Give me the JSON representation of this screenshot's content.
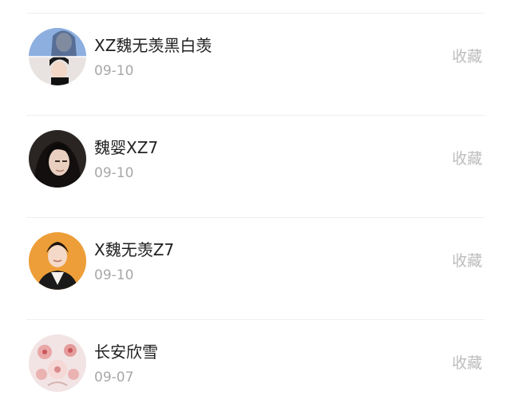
{
  "users": [
    {
      "name": "XZ魏无羡黑白羡",
      "date": "09-10",
      "action_label": "收藏",
      "avatar_icon": "avatar-split-blue-portrait"
    },
    {
      "name": "魏婴XZ7",
      "date": "09-10",
      "action_label": "收藏",
      "avatar_icon": "avatar-dark-long-hair-portrait"
    },
    {
      "name": "X魏无羡Z7",
      "date": "09-10",
      "action_label": "收藏",
      "avatar_icon": "avatar-orange-background-portrait"
    },
    {
      "name": "长安欣雪",
      "date": "09-07",
      "action_label": "收藏",
      "avatar_icon": "avatar-pink-floral"
    }
  ],
  "colors": {
    "name_text": "#222222",
    "date_text": "#a8a8a8",
    "action_text": "#bdbdbd",
    "divider": "#efefef"
  }
}
